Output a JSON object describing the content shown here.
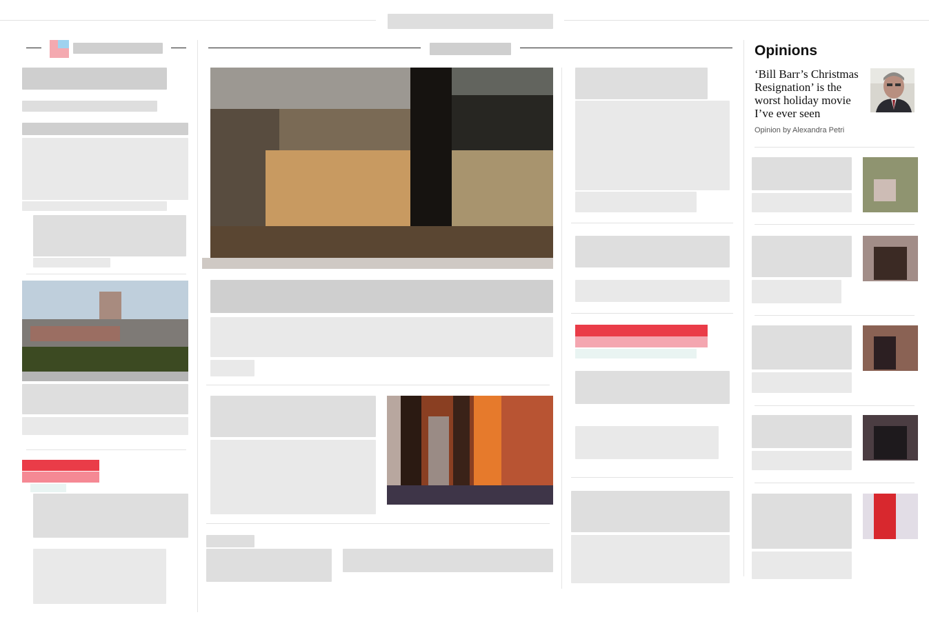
{
  "opinions": {
    "section_title": "Opinions",
    "lead": {
      "headline": "‘Bill Barr’s Christmas Resignation’ is the worst holiday movie I’ve ever seen",
      "byline": "Opinion by Alexandra Petri",
      "thumbnail_icon": "person-photo"
    }
  },
  "colors": {
    "rule": "#e2e2e2",
    "dark_rule": "#222222",
    "blur_gray": "#dedede",
    "accent_red": "#e8414a"
  }
}
